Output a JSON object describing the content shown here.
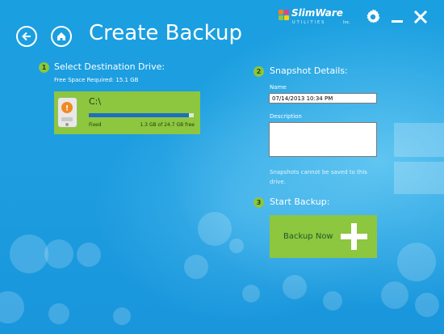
{
  "app": {
    "brand_name": "SlimWare",
    "brand_sub": "UTILITIES",
    "brand_badge": "Inc."
  },
  "header": {
    "title": "Create Backup"
  },
  "step1": {
    "number": "1",
    "title": "Select Destination Drive:",
    "space_required": "Free Space Required: 15.1 GB"
  },
  "drive": {
    "name": "C:\\",
    "type": "Fixed",
    "free": "1.3 GB of 24.7 GB free",
    "used_fraction": 0.95
  },
  "step2": {
    "number": "2",
    "title": "Snapshot Details:",
    "name_label": "Name",
    "name_value": "07/14/2013 10:34 PM",
    "description_label": "Description",
    "description_value": "",
    "note": "Snapshots cannot be saved to this drive."
  },
  "step3": {
    "number": "3",
    "title": "Start Backup:",
    "button_label": "Backup Now"
  },
  "colors": {
    "accent_green": "#8dc63f",
    "background_blue": "#1e9ee0",
    "drive_bar": "#1c6fc1"
  }
}
